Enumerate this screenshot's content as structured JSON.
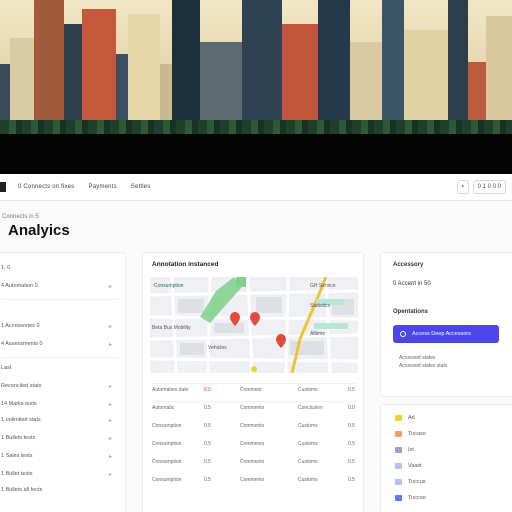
{
  "nav": {
    "items": [
      "0 Connects on fixes",
      "Payments",
      "Settles"
    ],
    "right_buttons": [
      "",
      "0 1 0 0 0"
    ]
  },
  "page": {
    "breadcrumb": "Connects in 5",
    "title": "Analyics"
  },
  "sidebar": {
    "items": [
      {
        "label": "1. 0"
      },
      {
        "label": "4 Automation 0"
      },
      {
        "label": "1 Accessories 0"
      },
      {
        "label": "4 Assessments 0"
      },
      {
        "label": "Last"
      },
      {
        "label": "Reconciled stats"
      },
      {
        "label": "14 Marks tests"
      },
      {
        "label": "1 unlimited stats"
      },
      {
        "label": "1 Bullets tests"
      },
      {
        "label": "1 Sales tests"
      },
      {
        "label": "1 Bullet tests"
      },
      {
        "label": "1 Bullets all fects"
      }
    ]
  },
  "center_panel": {
    "title": "Annotation instanced",
    "map_labels": [
      "Consumption",
      "GH Service",
      "Statistics",
      "Beta Bus Mobility",
      "Alltime",
      "Vehicles"
    ],
    "table_rows": [
      [
        "Automation date",
        "8.5",
        "Comment",
        "Customs",
        "0.5"
      ],
      [
        "Automatic",
        "0.5",
        "Comments",
        "Conclusion",
        "0.0"
      ],
      [
        "Consumption",
        "0.5",
        "Comments",
        "Customs",
        "0.5"
      ],
      [
        "Consumption",
        "0.5",
        "Comments",
        "Customs",
        "0.5"
      ],
      [
        "Consumption",
        "0.5",
        "Comments",
        "Customs",
        "0.5"
      ],
      [
        "Consumption",
        "0.5",
        "Comments",
        "Customs",
        "0.5"
      ]
    ]
  },
  "right_panel": {
    "title": "Accessory",
    "value": "0 Accent in 50",
    "subtitle": "Opentations",
    "cta": "Access Deep Accessors",
    "sub_rows": [
      "Accessed states",
      "Accessed states stats"
    ]
  },
  "right_list": {
    "items": [
      {
        "label": "Ad",
        "color": "#e9d332"
      },
      {
        "label": "Tucaso",
        "color": "#f0a35c"
      },
      {
        "label": "Ist",
        "color": "#9aa0d6"
      },
      {
        "label": "Vaast",
        "color": "#b6bdf2"
      },
      {
        "label": "Tuccus",
        "color": "#b6bdf2"
      },
      {
        "label": "Tuccoo",
        "color": "#5b7cf0"
      }
    ]
  },
  "colors": {
    "accent": "#4a46e8",
    "map_park": "#7ed08a",
    "map_road": "#f1c232",
    "pin": "#e24b3b"
  }
}
